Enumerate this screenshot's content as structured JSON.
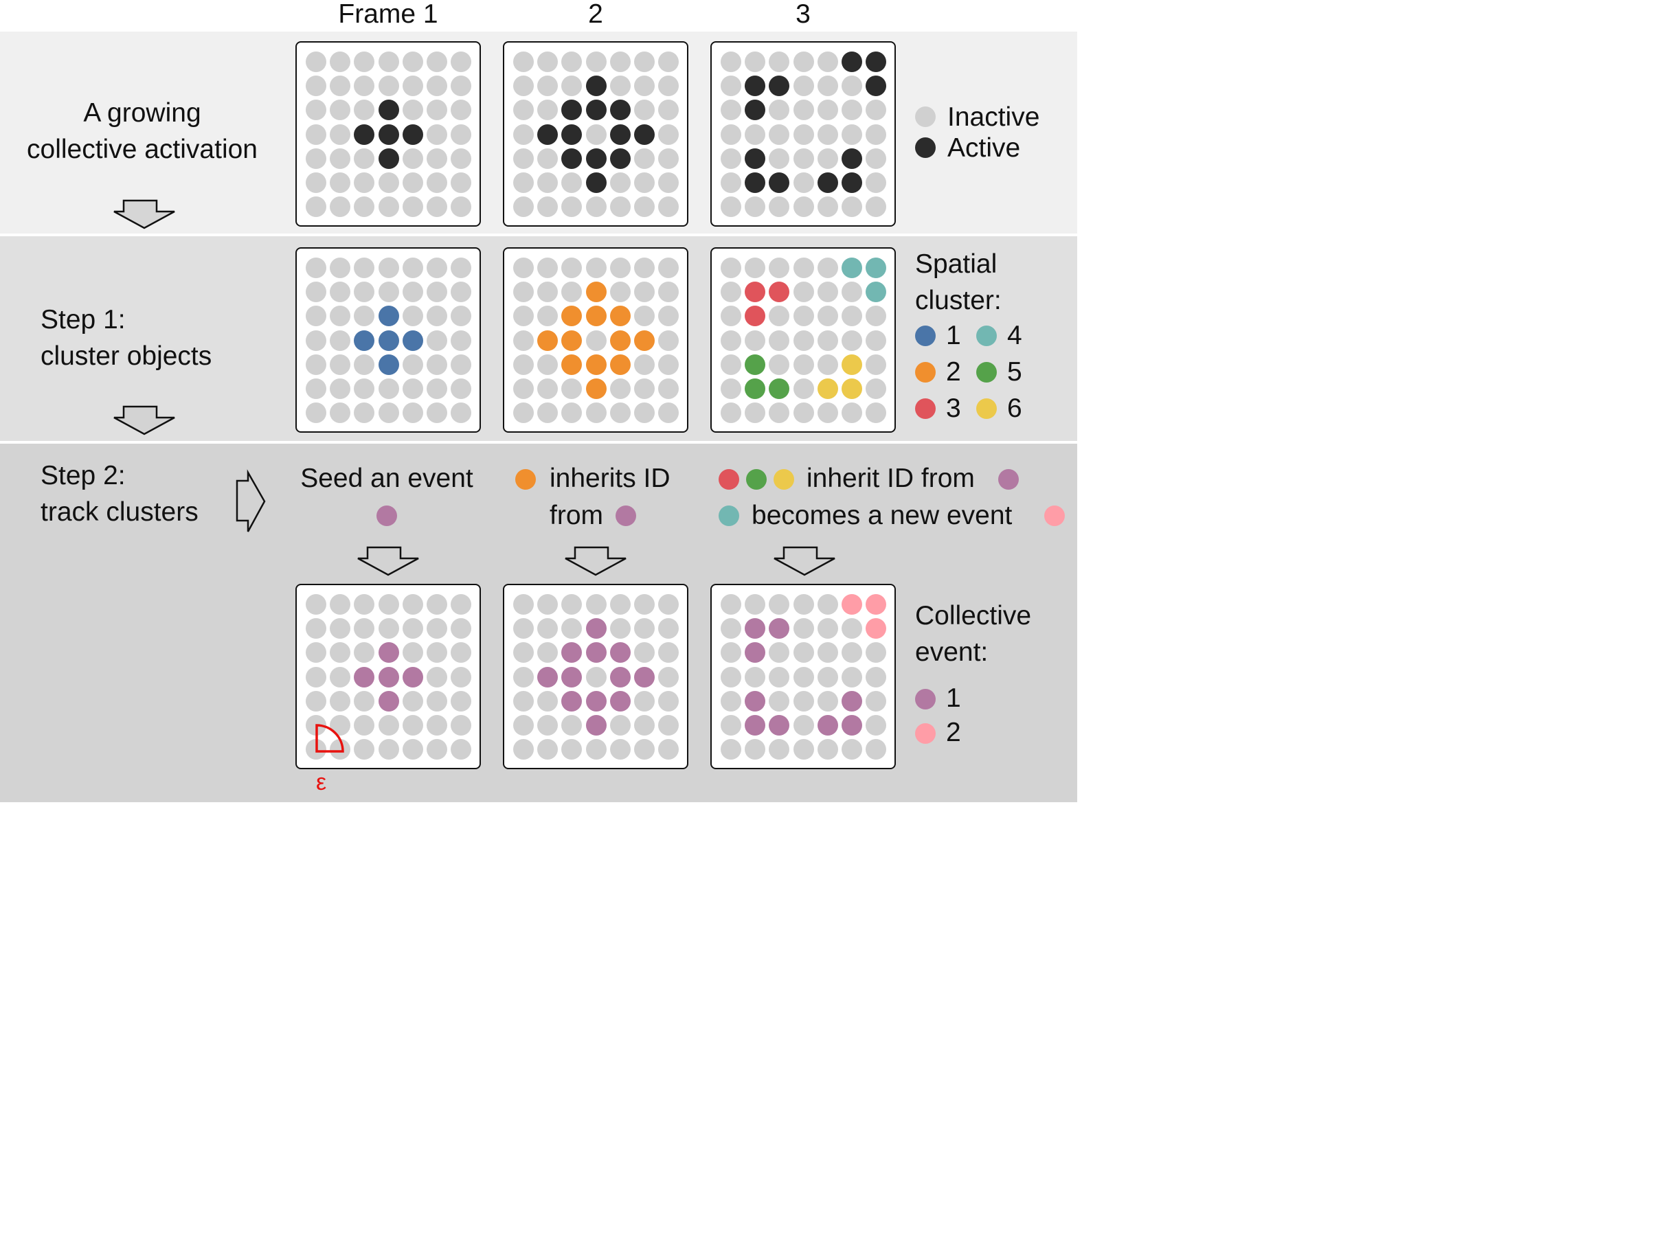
{
  "header": {
    "frame_labels": [
      "Frame 1",
      "2",
      "3"
    ]
  },
  "rows": {
    "activation": {
      "label_line1": "A growing",
      "label_line2": "collective activation"
    },
    "step1": {
      "label_line1": "Step 1:",
      "label_line2": "cluster objects"
    },
    "step2": {
      "label_line1": "Step 2:",
      "label_line2": "track clusters"
    }
  },
  "legend_activity": {
    "inactive": "Inactive",
    "active": "Active"
  },
  "legend_cluster": {
    "title_line1": "Spatial",
    "title_line2": "cluster:",
    "entries": [
      {
        "label": "1",
        "color": "#4a75a8"
      },
      {
        "label": "2",
        "color": "#f08f2e"
      },
      {
        "label": "3",
        "color": "#e0545b"
      },
      {
        "label": "4",
        "color": "#72b7b2"
      },
      {
        "label": "5",
        "color": "#55a24a"
      },
      {
        "label": "6",
        "color": "#ecc94b"
      }
    ]
  },
  "legend_event": {
    "title_line1": "Collective",
    "title_line2": "event:",
    "entries": [
      {
        "label": "1",
        "color": "#b279a2"
      },
      {
        "label": "2",
        "color": "#ff9da7"
      }
    ]
  },
  "tracking_text": {
    "frame1": "Seed an event",
    "frame2_line1": "inherits ID",
    "frame2_line2": "from",
    "frame3_line1": "inherit ID from",
    "frame3_line2": "becomes a new event"
  },
  "epsilon": "ε",
  "colors": {
    "inactive": "#d0d0d0",
    "active": "#2b2b2b",
    "cluster": {
      "1": "#4a75a8",
      "2": "#f08f2e",
      "3": "#e0545b",
      "4": "#72b7b2",
      "5": "#55a24a",
      "6": "#ecc94b"
    },
    "event": {
      "1": "#b279a2",
      "2": "#ff9da7"
    },
    "epsilon": "#e8120f"
  },
  "grids": {
    "activity": [
      [
        "0000000",
        "0000000",
        "0001000",
        "0011100",
        "0001000",
        "0000000",
        "0000000"
      ],
      [
        "0000000",
        "0001000",
        "0011100",
        "0110110",
        "0011100",
        "0001000",
        "0000000"
      ],
      [
        "0000011",
        "0110001",
        "0100000",
        "0000000",
        "0100010",
        "0110110",
        "0000000"
      ]
    ],
    "clusters": [
      [
        "0000000",
        "0000000",
        "0001000",
        "0011100",
        "0001000",
        "0000000",
        "0000000"
      ],
      [
        "0000000",
        "0002000",
        "0022200",
        "0220220",
        "0022200",
        "0002000",
        "0000000"
      ],
      [
        "0000044",
        "0330004",
        "0300000",
        "0000000",
        "0500060",
        "0550660",
        "0000000"
      ]
    ],
    "events": [
      [
        "0000000",
        "0000000",
        "0001000",
        "0011100",
        "0001000",
        "0000000",
        "0000000"
      ],
      [
        "0000000",
        "0001000",
        "0011100",
        "0110110",
        "0011100",
        "0001000",
        "0000000"
      ],
      [
        "0000022",
        "0110002",
        "0100000",
        "0000000",
        "0100010",
        "0110110",
        "0000000"
      ]
    ]
  }
}
